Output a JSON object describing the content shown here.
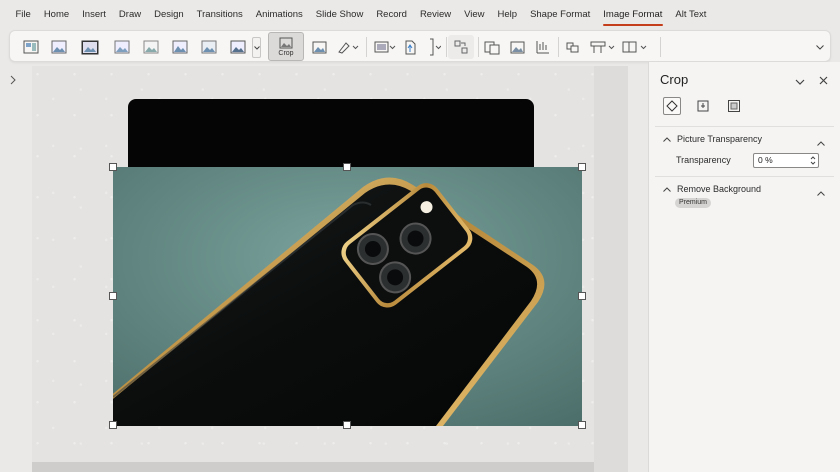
{
  "menu": {
    "items": [
      "File",
      "Home",
      "Insert",
      "Draw",
      "Design",
      "Transitions",
      "Animations",
      "Slide Show",
      "Record",
      "Review",
      "View",
      "Help",
      "Shape Format",
      "Image Format",
      "Alt Text"
    ],
    "active_index": 13,
    "accent_color": "#c43e1c"
  },
  "ribbon": {
    "crop_label": "Crop",
    "icons": [
      "picture-style-icon",
      "picture-style-icon",
      "picture-style-icon",
      "picture-style-icon",
      "picture-style-icon",
      "picture-style-icon",
      "picture-style-icon",
      "picture-style-icon",
      "crop-icon",
      "image-icon",
      "artistic-effects-icon",
      "picture-layout-icon",
      "change-picture-icon",
      "align-icon",
      "group-icon",
      "rotate-icon",
      "reset-icon",
      "bring-forward-icon",
      "send-backward-icon",
      "selection-pane-icon",
      "collapse-ribbon-icon"
    ]
  },
  "panel": {
    "title": "Crop",
    "tabs": [
      "fill-line-icon",
      "effects-icon",
      "size-properties-icon"
    ],
    "picture_transparency": {
      "heading": "Picture Transparency",
      "label": "Transparency",
      "value": "0 %"
    },
    "remove_background": {
      "heading": "Remove Background",
      "badge": "Premium"
    }
  }
}
